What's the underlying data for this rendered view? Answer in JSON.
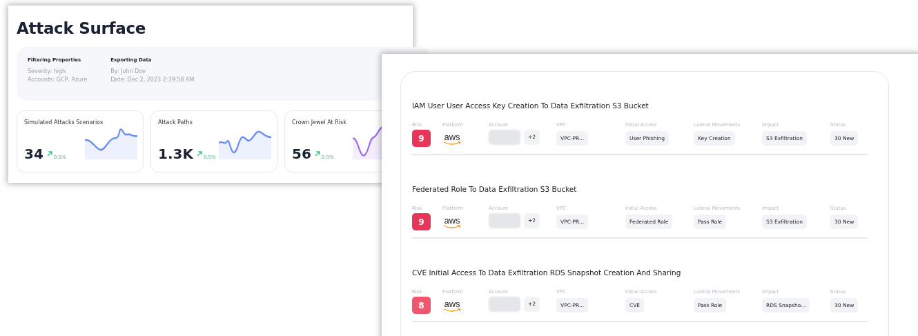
{
  "back_window": {
    "title": "Attack Surface",
    "filter_panel": [
      {
        "heading": "Filtering Properties",
        "lines": [
          "Severity: high",
          "Accounts: GCP, Azure"
        ]
      },
      {
        "heading": "Exporting Data",
        "lines": [
          "By: John Doe",
          "Date: Dec 2, 2023 2:39:58 AM"
        ]
      }
    ],
    "stats": [
      {
        "label": "Simulated Attacks Scenarios",
        "value": "34",
        "change": "0.5%",
        "color": "#6b8ff2"
      },
      {
        "label": "Attack Paths",
        "value": "1.3K",
        "change": "0.5%",
        "color": "#6b8ff2"
      },
      {
        "label": "Crown Jewel At Risk",
        "value": "56",
        "change": "0.5%",
        "color": "#9b6cf0"
      }
    ]
  },
  "front_window": {
    "scenarios": [
      {
        "title": "IAM User User Access Key Creation To Data Exfiltration S3 Bucket",
        "fields": [
          {
            "kind": "risk",
            "label": "Risk",
            "value": "9",
            "color": "#e8365a"
          },
          {
            "kind": "platform",
            "label": "Platform",
            "value": "aws"
          },
          {
            "kind": "account",
            "label": "Account",
            "extra": "+2"
          },
          {
            "kind": "chip",
            "label": "VPC",
            "value": "VPC-PR..."
          },
          {
            "kind": "chip",
            "label": "Initial Access",
            "value": "User Phishing"
          },
          {
            "kind": "chip",
            "label": "Lateral Movements",
            "value": "Key Creation"
          },
          {
            "kind": "chip",
            "label": "Impact",
            "value": "S3 Exfiltration"
          },
          {
            "kind": "chip",
            "label": "Status",
            "value": "30 New"
          }
        ]
      },
      {
        "title": "Federated Role To Data Exfiltration S3 Bucket",
        "fields": [
          {
            "kind": "risk",
            "label": "Risk",
            "value": "9",
            "color": "#e8365a"
          },
          {
            "kind": "platform",
            "label": "Platform",
            "value": "aws"
          },
          {
            "kind": "account",
            "label": "Account",
            "extra": "+2"
          },
          {
            "kind": "chip",
            "label": "VPC",
            "value": "VPC-PR..."
          },
          {
            "kind": "chip",
            "label": "Initial Access",
            "value": "Federated Role"
          },
          {
            "kind": "chip",
            "label": "Lateral Movements",
            "value": "Pass Role"
          },
          {
            "kind": "chip",
            "label": "Impact",
            "value": "S3 Exfiltration"
          },
          {
            "kind": "chip",
            "label": "Status",
            "value": "30 New"
          }
        ]
      },
      {
        "title": "CVE Initial Access To Data Exfiltration RDS Snapshot Creation And Sharing",
        "fields": [
          {
            "kind": "risk",
            "label": "Risk",
            "value": "8",
            "color": "#f0566e"
          },
          {
            "kind": "platform",
            "label": "Platform",
            "value": "aws"
          },
          {
            "kind": "account",
            "label": "Account",
            "extra": "+2"
          },
          {
            "kind": "chip",
            "label": "VPC",
            "value": "VPC-PR..."
          },
          {
            "kind": "chip",
            "label": "Initial Access",
            "value": "CVE"
          },
          {
            "kind": "chip",
            "label": "Lateral Movements",
            "value": "Pass Role"
          },
          {
            "kind": "chip",
            "label": "Impact",
            "value": "RDS Snapsho..."
          },
          {
            "kind": "chip",
            "label": "Status",
            "value": "30 New"
          }
        ]
      }
    ]
  }
}
